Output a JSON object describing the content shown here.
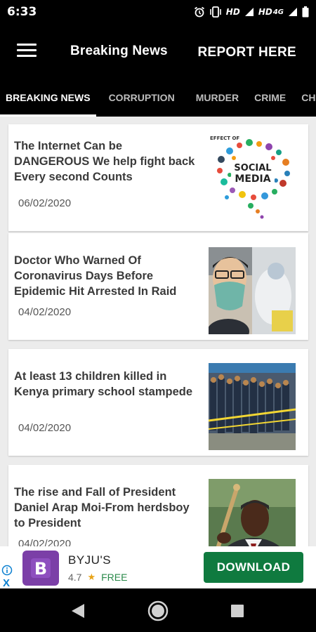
{
  "status_bar": {
    "time": "6:33",
    "network_label_1": "HD",
    "network_label_2": "HD",
    "network_label_3": "4G"
  },
  "app_bar": {
    "title": "Breaking News",
    "report_label": "REPORT HERE"
  },
  "tabs": [
    {
      "label": "BREAKING NEWS",
      "active": true
    },
    {
      "label": "CORRUPTION",
      "active": false
    },
    {
      "label": "MURDER",
      "active": false
    },
    {
      "label": "CRIME",
      "active": false
    },
    {
      "label": "CHI",
      "active": false
    }
  ],
  "articles": [
    {
      "title": "The Internet Can be DANGEROUS We help fight back Every second Counts",
      "date": "06/02/2020",
      "thumb_icon": "social-media-graphic"
    },
    {
      "title": "Doctor Who Warned Of Coronavirus Days Before Epidemic Hit Arrested In Raid",
      "date": "04/02/2020",
      "thumb_icon": "doctor-photo"
    },
    {
      "title": "At least 13 children killed in Kenya primary school stampede",
      "date": "04/02/2020",
      "thumb_icon": "crowd-photo"
    },
    {
      "title": "The rise and Fall of President Daniel Arap Moi-From herdsboy to President",
      "date": "04/02/2020",
      "thumb_icon": "president-photo"
    }
  ],
  "thumb_text": {
    "effect_of": "EFFECT OF",
    "social": "SOCIAL",
    "media": "MEDIA"
  },
  "ad": {
    "app_name": "BYJU'S",
    "logo_letter": "B",
    "rating": "4.7",
    "price": "FREE",
    "cta": "DOWNLOAD",
    "close": "X"
  },
  "colors": {
    "bar_background": "#000000",
    "list_background": "#ececec",
    "ad_cta": "#0f7a3f",
    "ad_logo": "#7b3fa7"
  }
}
